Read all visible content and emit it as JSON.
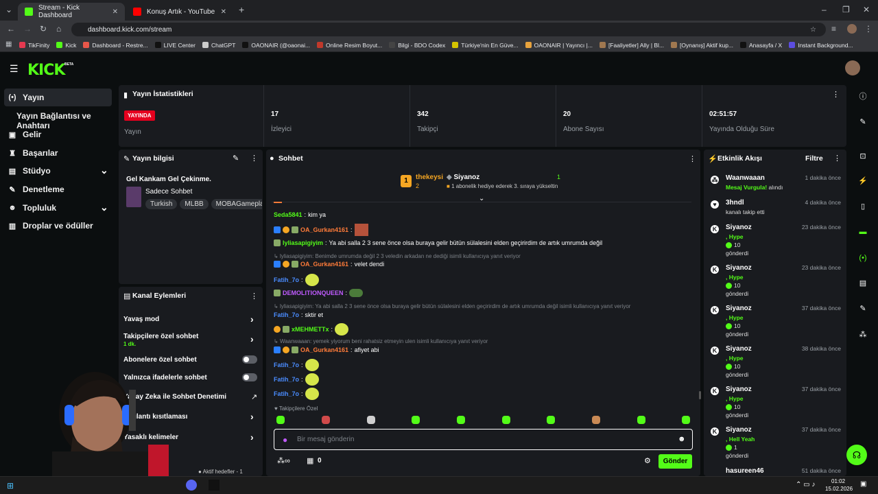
{
  "browser": {
    "tabs": [
      {
        "title": "Stream - Kick Dashboard",
        "color": "#53fc18"
      },
      {
        "title": "Konuş Artık - YouTube",
        "color": "#ff0000"
      }
    ],
    "url": "dashboard.kick.com/stream",
    "bookmarks": [
      {
        "label": "TikFinity",
        "color": "#e53950"
      },
      {
        "label": "Kick",
        "color": "#53fc18"
      },
      {
        "label": "Dashboard - Restre...",
        "color": "#e8574a"
      },
      {
        "label": "LIVE Center",
        "color": "#111111"
      },
      {
        "label": "ChatGPT",
        "color": "#cccccc"
      },
      {
        "label": "OAONAIR (@oaonai...",
        "color": "#111111"
      },
      {
        "label": "Online Resim Boyut...",
        "color": "#c0392b"
      },
      {
        "label": "Bilgi - BDO Codex",
        "color": "#444444"
      },
      {
        "label": "Türkiye'nin En Güve...",
        "color": "#d4c400"
      },
      {
        "label": "OAONAIR | Yayıncı |...",
        "color": "#e8a33d"
      },
      {
        "label": "[Faaliyetler] Ally | Bl...",
        "color": "#a07850"
      },
      {
        "label": "[Oynanış] Aktif kup...",
        "color": "#a07850"
      },
      {
        "label": "Anasayfa / X",
        "color": "#111111"
      },
      {
        "label": "Instant Background...",
        "color": "#5c4de0"
      }
    ]
  },
  "kick": {
    "logo": "KICK",
    "beta": "BETA"
  },
  "sidebar": {
    "items": [
      {
        "label": "Yayın",
        "icon": "broadcast-icon"
      },
      {
        "label": "Yayın Bağlantısı ve Anahtarı",
        "icon": ""
      },
      {
        "label": "Gelir",
        "icon": "wallet-icon"
      },
      {
        "label": "Başarılar",
        "icon": "trophy-icon"
      },
      {
        "label": "Stüdyo",
        "icon": "studio-icon"
      },
      {
        "label": "Denetleme",
        "icon": "wrench-icon"
      },
      {
        "label": "Topluluk",
        "icon": "users-icon"
      },
      {
        "label": "Droplar ve ödüller",
        "icon": "gift-icon"
      }
    ]
  },
  "stats": {
    "title": "Yayın İstatistikleri",
    "live_badge": "YAYINDA",
    "live_label": "Yayın",
    "items": [
      {
        "value": "17",
        "label": "İzleyici"
      },
      {
        "value": "342",
        "label": "Takipçi"
      },
      {
        "value": "20",
        "label": "Abone Sayısı"
      },
      {
        "value": "02:51:57",
        "label": "Yayında Olduğu Süre"
      }
    ]
  },
  "stream_info": {
    "title": "Yayın bilgisi",
    "stream_title": "Gel Kankam Gel Çekinme.",
    "category": "Sadece Sohbet",
    "tags": [
      "Turkish",
      "MLBB",
      "MOBAGameplay"
    ]
  },
  "channel_actions": {
    "title": "Kanal Eylemleri",
    "items": [
      {
        "label": "Yavaş mod",
        "sub": ""
      },
      {
        "label": "Takipçilere özel sohbet",
        "sub": "1 dk."
      },
      {
        "label": "Abonelere özel sohbet",
        "sub": ""
      },
      {
        "label": "Yalnızca ifadelerle sohbet",
        "sub": ""
      },
      {
        "label": "Yapay Zeka ile Sohbet Denetimi",
        "sub": ""
      },
      {
        "label": "Bağlantı kısıtlaması",
        "sub": ""
      },
      {
        "label": "Yasaklı kelimeler",
        "sub": ""
      }
    ],
    "footer": "Aktif hedefler - 1"
  },
  "chat": {
    "title": "Sohbet",
    "leaderboard": {
      "left_name": "thekeysi",
      "left_count": "2",
      "right_name": "Siyanoz",
      "right_count": "1",
      "right_sub": "1 abonelik hediye ederek 3. sıraya yükseltin"
    },
    "messages": [
      {
        "user": "Seda5841",
        "color": "#53fc18",
        "text": "kim ya"
      },
      {
        "user": "OA_Gurkan4161",
        "color": "#ff7b39",
        "text": ""
      },
      {
        "user": "lyliasapigiyim",
        "color": "#53fc18",
        "text": "Ya abi salla 2 3 sene önce olsa buraya gelir bütün sülalesini elden geçirirdim de artık umrumda değil"
      },
      {
        "reply": "lyliasapigiyim: Benimde umrumda değil 2 3 veledin arkadan ne dediği isimli kullanıcıya yanıt veriyor"
      },
      {
        "user": "OA_Gurkan4161",
        "color": "#ff7b39",
        "text": "velet dendi"
      },
      {
        "user": "Fatih_7o",
        "color": "#4a8cff",
        "text": ""
      },
      {
        "user": "DEMOLITIONQUEEN",
        "color": "#c05bff",
        "text": ""
      },
      {
        "reply": "lyliasapigiyim: Ya abi salla 2 3 sene önce olsa buraya gelir bütün sülalesini elden geçirirdim de artık umrumda değil isimli kullanıcıya yanıt veriyor"
      },
      {
        "user": "Fatih_7o",
        "color": "#4a8cff",
        "text": "sktir et"
      },
      {
        "user": "xMEHMETTx",
        "color": "#53fc18",
        "text": ""
      },
      {
        "reply": "Waanwaaan: yemek yiyorum beni rahatsiz etmeyin ulen isimli kullanıcıya yanıt veriyor"
      },
      {
        "user": "OA_Gurkan4161",
        "color": "#ff7b39",
        "text": "afiyet abi"
      },
      {
        "user": "Fatih_7o",
        "color": "#4a8cff",
        "text": ""
      },
      {
        "user": "Fatih_7o",
        "color": "#4a8cff",
        "text": ""
      },
      {
        "user": "Fatih_7o",
        "color": "#4a8cff",
        "text": ""
      }
    ],
    "followers_only": "Takipçilere Özel",
    "input_placeholder": "Bir mesaj gönderin",
    "send": "Gönder",
    "count": "0"
  },
  "activity": {
    "title": "Etkinlik Akışı",
    "filter": "Filtre",
    "events": [
      {
        "name": "Waanwaaan",
        "time": "1 dakika önce",
        "a": "Mesaj Vurgula!",
        "a_suffix": " alındı",
        "b": "",
        "c": "",
        "icon": "users-icon"
      },
      {
        "name": "3hndl",
        "time": "4 dakika önce",
        "a": "",
        "a_suffix": "",
        "b": "kanalı takip etti",
        "c": "",
        "icon": "heart-icon"
      },
      {
        "name": "Siyanoz",
        "time": "23 dakika önce",
        "a": ", Hype",
        "a_suffix": "",
        "b": "10",
        "c": "gönderdi",
        "icon": "kick-icon"
      },
      {
        "name": "Siyanoz",
        "time": "23 dakika önce",
        "a": ", Hype",
        "a_suffix": "",
        "b": "10",
        "c": "gönderdi",
        "icon": "kick-icon"
      },
      {
        "name": "Siyanoz",
        "time": "37 dakika önce",
        "a": ", Hype",
        "a_suffix": "",
        "b": "10",
        "c": "gönderdi",
        "icon": "kick-icon"
      },
      {
        "name": "Siyanoz",
        "time": "38 dakika önce",
        "a": ", Hype",
        "a_suffix": "",
        "b": "10",
        "c": "gönderdi",
        "icon": "kick-icon"
      },
      {
        "name": "Siyanoz",
        "time": "37 dakika önce",
        "a": ", Hype",
        "a_suffix": "",
        "b": "10",
        "c": "gönderdi",
        "icon": "kick-icon"
      },
      {
        "name": "Siyanoz",
        "time": "37 dakika önce",
        "a": ", Hell Yeah",
        "a_suffix": "",
        "b": "1",
        "c": "gönderdi",
        "icon": "kick-icon"
      }
    ],
    "last_partial": "hasureen46",
    "last_time": "51 dakika önce"
  },
  "taskbar": {
    "time": "01:02",
    "date": "15.02.2026"
  }
}
